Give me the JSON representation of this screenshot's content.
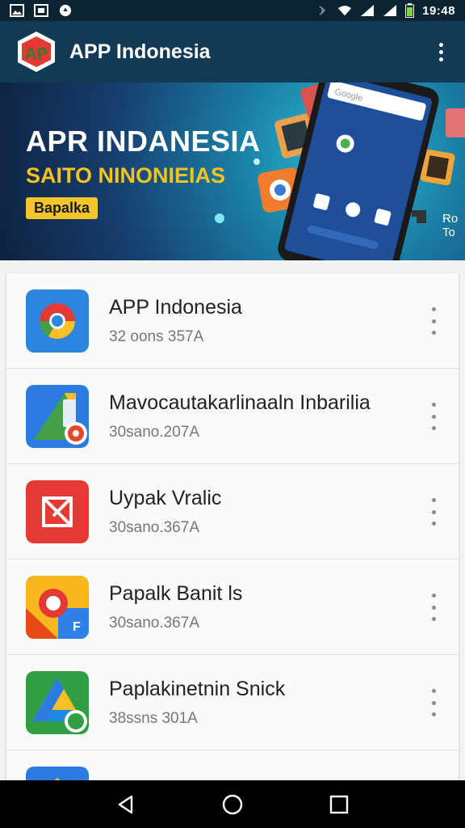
{
  "status_bar": {
    "time": "19:48",
    "left_icons": [
      "image-icon",
      "gallery-icon",
      "app-badge-icon"
    ],
    "right_icons": [
      "bluetooth-icon",
      "wifi-icon",
      "signal-icon",
      "signal-icon",
      "battery-icon"
    ]
  },
  "app_bar": {
    "title": "APP Indonesia",
    "menu_icon": "more-vert-icon"
  },
  "banner": {
    "title": "APR INDANESIA",
    "subtitle": "SAITO NINONIEIAS",
    "chip": "Bapalka",
    "side_text_1": "Ro",
    "side_text_2": "To"
  },
  "apps": [
    {
      "title": "APP Indonesia",
      "meta": "32 oons 357A",
      "icon": "chrome-style-icon"
    },
    {
      "title": "Mavocautakarlinaaln Inbarilia",
      "meta": "30sano.207A",
      "icon": "maps-style-icon"
    },
    {
      "title": "Uypak Vralic",
      "meta": "30sano.367A",
      "icon": "red-envelope-icon"
    },
    {
      "title": "Papalk Banit ls",
      "meta": "30sano.367A",
      "icon": "yellow-app-icon"
    },
    {
      "title": "Paplakinetnin Snick",
      "meta": "38ssns 301A",
      "icon": "drive-style-icon"
    }
  ],
  "nav": {
    "back": "back-icon",
    "home": "home-icon",
    "recents": "recents-icon"
  },
  "colors": {
    "app_bar": "#123a55",
    "status_bar": "#0b2433",
    "banner_accent": "#f5c320",
    "logo_red": "#e53935"
  }
}
